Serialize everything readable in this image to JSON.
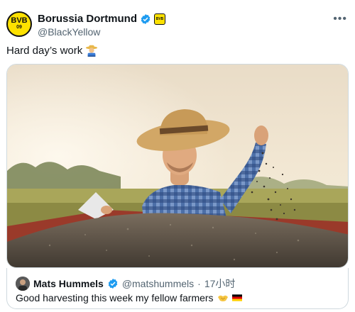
{
  "author": {
    "display_name": "Borussia Dortmund",
    "handle": "@BlackYellow",
    "avatar_text": "BVB",
    "avatar_sub": "09"
  },
  "tweet": {
    "text": "Hard day’s work"
  },
  "quote": {
    "display_name": "Mats Hummels",
    "handle": "@matshummels",
    "separator": "·",
    "time": "17小时",
    "text": "Good harvesting this week my fellow farmers"
  },
  "colors": {
    "verified_blue": "#1d9bf0",
    "bvb_yellow": "#fde100",
    "secondary_text": "#536471"
  },
  "icons": {
    "verified": "verified-badge-icon",
    "more": "more-options-icon",
    "farmer": "farmer-emoji-icon",
    "handshake": "handshake-emoji-icon",
    "flag": "germany-flag-icon"
  }
}
